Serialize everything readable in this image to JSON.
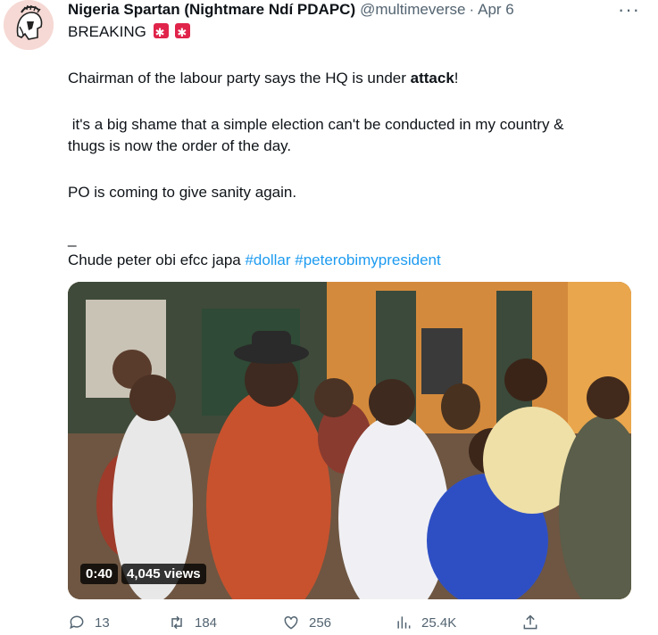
{
  "tweet": {
    "display_name": "Nigeria Spartan (Nightmare Ndí PDAPC)",
    "handle": "@multimeverse",
    "separator": "·",
    "date": "Apr 6",
    "more_label": "···",
    "line1": "BREAKING",
    "para2_before": "Chairman of the labour party says the HQ is under ",
    "para2_bold": "attack",
    "para2_after": "!",
    "para3_line1": " it's a big shame that a simple election can't be conducted in my country &",
    "para3_line2": "thugs is now the order of the day.",
    "para4": "PO is coming to give sanity again.",
    "underscore": "_",
    "last_text": "Chude peter obi efcc japa ",
    "hashtag1": "#dollar",
    "hashtag2": "#peterobimypresident"
  },
  "video": {
    "duration": "0:40",
    "views": "4,045 views"
  },
  "actions": {
    "replies": "13",
    "retweets": "184",
    "likes": "256",
    "views": "25.4K"
  },
  "colors": {
    "text": "#0f1419",
    "secondary": "#536471",
    "link": "#1d9bf0",
    "siren": "#e0244a"
  },
  "icons": {
    "reply": "reply-icon",
    "retweet": "retweet-icon",
    "like": "heart-icon",
    "views": "bar-chart-icon",
    "share": "share-icon",
    "avatar": "spartan-helmet-avatar"
  }
}
